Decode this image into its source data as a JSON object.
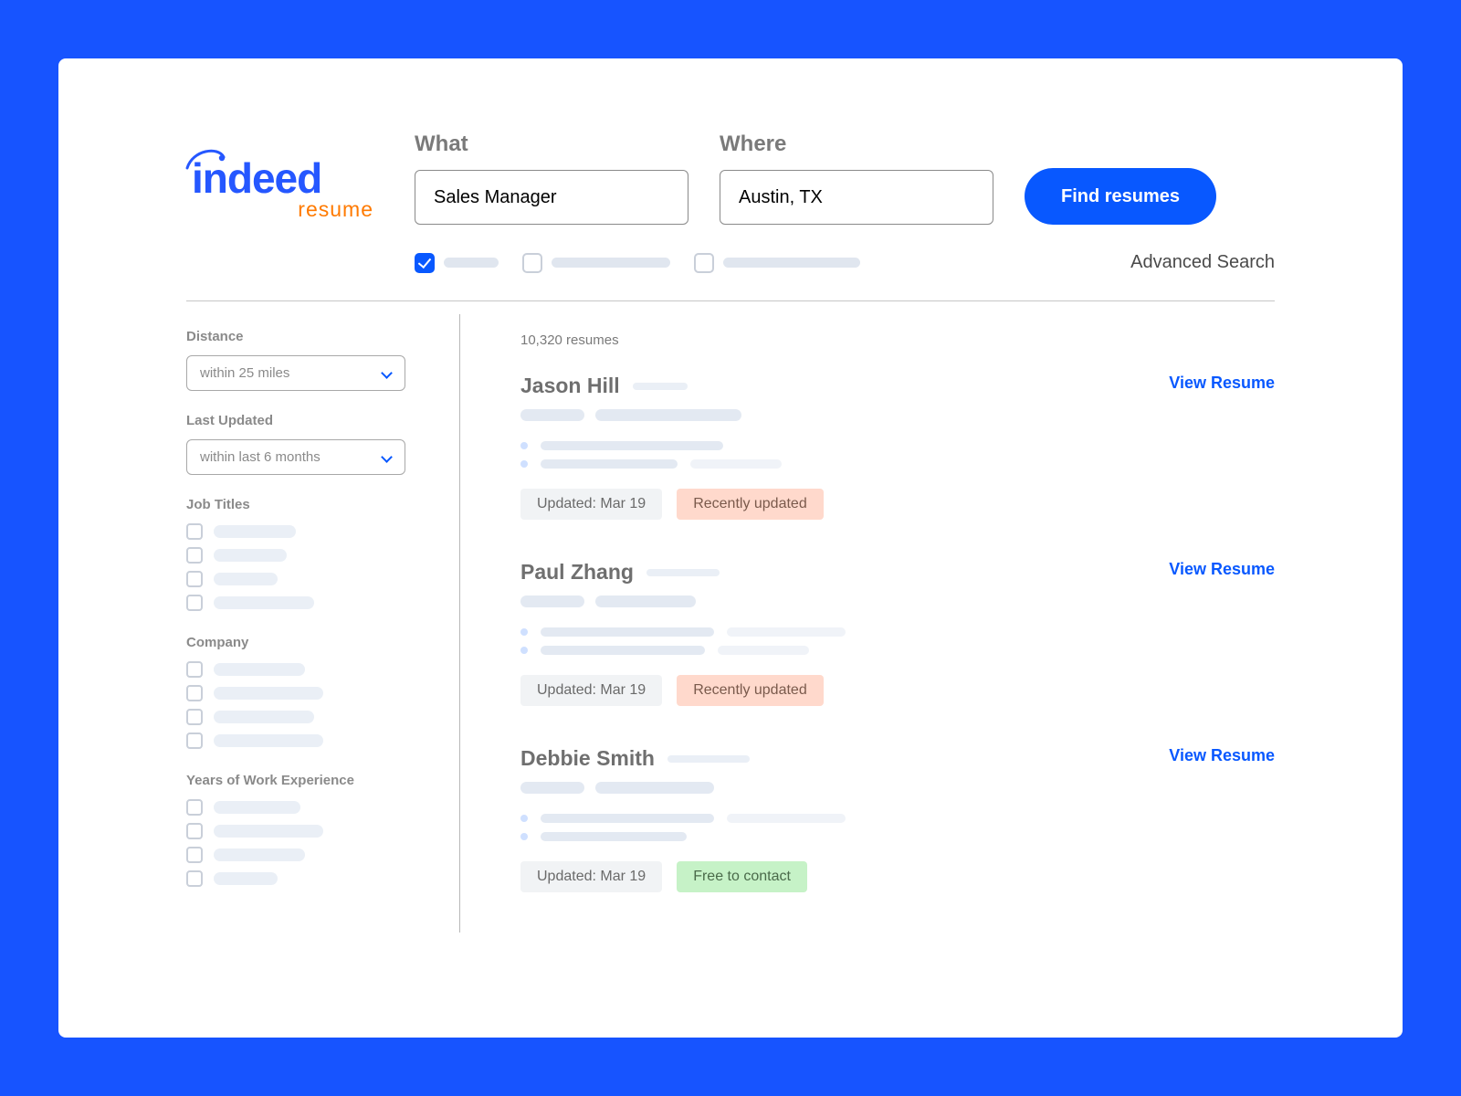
{
  "logo": {
    "main": "indeed",
    "sub": "resume"
  },
  "search": {
    "what_label": "What",
    "where_label": "Where",
    "what_value": "Sales Manager",
    "where_value": "Austin, TX",
    "button": "Find resumes",
    "advanced": "Advanced Search"
  },
  "sidebar": {
    "distance_label": "Distance",
    "distance_value": "within 25 miles",
    "last_updated_label": "Last Updated",
    "last_updated_value": "within last 6 months",
    "job_titles_label": "Job Titles",
    "company_label": "Company",
    "years_label": "Years of Work Experience"
  },
  "results": {
    "count": "10,320 resumes",
    "view_label": "View Resume",
    "items": [
      {
        "name": "Jason Hill",
        "updated": "Updated: Mar 19",
        "badge": "Recently updated",
        "badge_type": "orange"
      },
      {
        "name": "Paul Zhang",
        "updated": "Updated: Mar 19",
        "badge": "Recently updated",
        "badge_type": "orange"
      },
      {
        "name": "Debbie Smith",
        "updated": "Updated: Mar 19",
        "badge": "Free to contact",
        "badge_type": "green"
      }
    ]
  }
}
